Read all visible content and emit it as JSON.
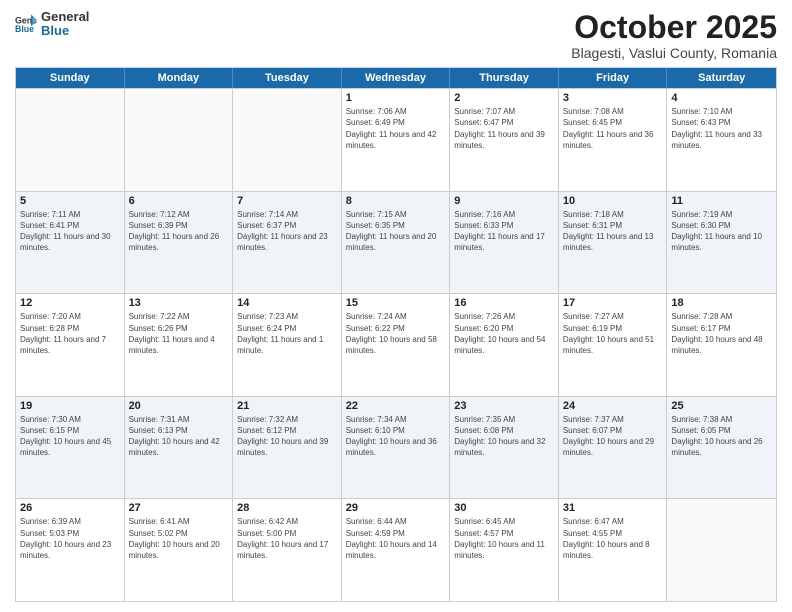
{
  "logo": {
    "general": "General",
    "blue": "Blue"
  },
  "header": {
    "month": "October 2025",
    "location": "Blagesti, Vaslui County, Romania"
  },
  "days": [
    "Sunday",
    "Monday",
    "Tuesday",
    "Wednesday",
    "Thursday",
    "Friday",
    "Saturday"
  ],
  "weeks": [
    [
      {
        "day": "",
        "info": ""
      },
      {
        "day": "",
        "info": ""
      },
      {
        "day": "",
        "info": ""
      },
      {
        "day": "1",
        "info": "Sunrise: 7:06 AM\nSunset: 6:49 PM\nDaylight: 11 hours and 42 minutes."
      },
      {
        "day": "2",
        "info": "Sunrise: 7:07 AM\nSunset: 6:47 PM\nDaylight: 11 hours and 39 minutes."
      },
      {
        "day": "3",
        "info": "Sunrise: 7:08 AM\nSunset: 6:45 PM\nDaylight: 11 hours and 36 minutes."
      },
      {
        "day": "4",
        "info": "Sunrise: 7:10 AM\nSunset: 6:43 PM\nDaylight: 11 hours and 33 minutes."
      }
    ],
    [
      {
        "day": "5",
        "info": "Sunrise: 7:11 AM\nSunset: 6:41 PM\nDaylight: 11 hours and 30 minutes."
      },
      {
        "day": "6",
        "info": "Sunrise: 7:12 AM\nSunset: 6:39 PM\nDaylight: 11 hours and 26 minutes."
      },
      {
        "day": "7",
        "info": "Sunrise: 7:14 AM\nSunset: 6:37 PM\nDaylight: 11 hours and 23 minutes."
      },
      {
        "day": "8",
        "info": "Sunrise: 7:15 AM\nSunset: 6:35 PM\nDaylight: 11 hours and 20 minutes."
      },
      {
        "day": "9",
        "info": "Sunrise: 7:16 AM\nSunset: 6:33 PM\nDaylight: 11 hours and 17 minutes."
      },
      {
        "day": "10",
        "info": "Sunrise: 7:18 AM\nSunset: 6:31 PM\nDaylight: 11 hours and 13 minutes."
      },
      {
        "day": "11",
        "info": "Sunrise: 7:19 AM\nSunset: 6:30 PM\nDaylight: 11 hours and 10 minutes."
      }
    ],
    [
      {
        "day": "12",
        "info": "Sunrise: 7:20 AM\nSunset: 6:28 PM\nDaylight: 11 hours and 7 minutes."
      },
      {
        "day": "13",
        "info": "Sunrise: 7:22 AM\nSunset: 6:26 PM\nDaylight: 11 hours and 4 minutes."
      },
      {
        "day": "14",
        "info": "Sunrise: 7:23 AM\nSunset: 6:24 PM\nDaylight: 11 hours and 1 minute."
      },
      {
        "day": "15",
        "info": "Sunrise: 7:24 AM\nSunset: 6:22 PM\nDaylight: 10 hours and 58 minutes."
      },
      {
        "day": "16",
        "info": "Sunrise: 7:26 AM\nSunset: 6:20 PM\nDaylight: 10 hours and 54 minutes."
      },
      {
        "day": "17",
        "info": "Sunrise: 7:27 AM\nSunset: 6:19 PM\nDaylight: 10 hours and 51 minutes."
      },
      {
        "day": "18",
        "info": "Sunrise: 7:28 AM\nSunset: 6:17 PM\nDaylight: 10 hours and 48 minutes."
      }
    ],
    [
      {
        "day": "19",
        "info": "Sunrise: 7:30 AM\nSunset: 6:15 PM\nDaylight: 10 hours and 45 minutes."
      },
      {
        "day": "20",
        "info": "Sunrise: 7:31 AM\nSunset: 6:13 PM\nDaylight: 10 hours and 42 minutes."
      },
      {
        "day": "21",
        "info": "Sunrise: 7:32 AM\nSunset: 6:12 PM\nDaylight: 10 hours and 39 minutes."
      },
      {
        "day": "22",
        "info": "Sunrise: 7:34 AM\nSunset: 6:10 PM\nDaylight: 10 hours and 36 minutes."
      },
      {
        "day": "23",
        "info": "Sunrise: 7:35 AM\nSunset: 6:08 PM\nDaylight: 10 hours and 32 minutes."
      },
      {
        "day": "24",
        "info": "Sunrise: 7:37 AM\nSunset: 6:07 PM\nDaylight: 10 hours and 29 minutes."
      },
      {
        "day": "25",
        "info": "Sunrise: 7:38 AM\nSunset: 6:05 PM\nDaylight: 10 hours and 26 minutes."
      }
    ],
    [
      {
        "day": "26",
        "info": "Sunrise: 6:39 AM\nSunset: 5:03 PM\nDaylight: 10 hours and 23 minutes."
      },
      {
        "day": "27",
        "info": "Sunrise: 6:41 AM\nSunset: 5:02 PM\nDaylight: 10 hours and 20 minutes."
      },
      {
        "day": "28",
        "info": "Sunrise: 6:42 AM\nSunset: 5:00 PM\nDaylight: 10 hours and 17 minutes."
      },
      {
        "day": "29",
        "info": "Sunrise: 6:44 AM\nSunset: 4:59 PM\nDaylight: 10 hours and 14 minutes."
      },
      {
        "day": "30",
        "info": "Sunrise: 6:45 AM\nSunset: 4:57 PM\nDaylight: 10 hours and 11 minutes."
      },
      {
        "day": "31",
        "info": "Sunrise: 6:47 AM\nSunset: 4:55 PM\nDaylight: 10 hours and 8 minutes."
      },
      {
        "day": "",
        "info": ""
      }
    ]
  ]
}
